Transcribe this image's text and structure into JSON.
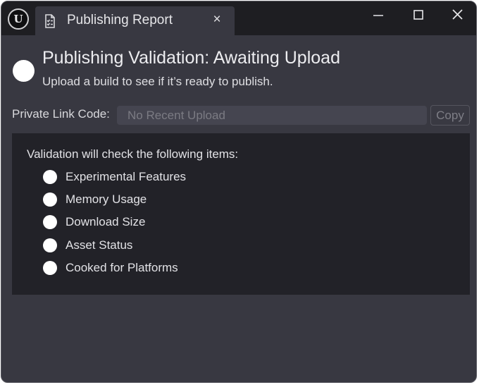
{
  "window": {
    "logo_glyph": "U",
    "tab_title": "Publishing Report",
    "tab_close_glyph": "×"
  },
  "status": {
    "title": "Publishing Validation: Awaiting Upload",
    "subtitle": "Upload a build to see if it’s ready to publish."
  },
  "link": {
    "label": "Private Link Code:",
    "value": "No Recent Upload",
    "copy_label": "Copy"
  },
  "checklist": {
    "heading": "Validation will check the following items:",
    "items": [
      "Experimental Features",
      "Memory Usage",
      "Download Size",
      "Asset Status",
      "Cooked for Platforms"
    ]
  },
  "icons": {
    "app": "unreal-logo-icon",
    "tab": "report-checklist-icon",
    "status": "status-circle-icon",
    "item": "pending-circle-icon"
  },
  "colors": {
    "window_bg": "#383841",
    "titlebar_bg": "#1e1e22",
    "panel_bg": "#222228",
    "field_bg": "#454550",
    "status_dot": "#ffffff"
  }
}
